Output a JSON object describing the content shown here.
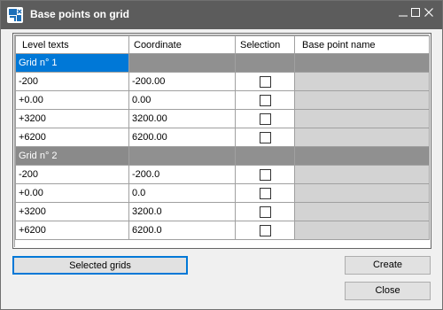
{
  "window": {
    "title": "Base points on grid"
  },
  "table": {
    "headers": [
      "Level texts",
      "Coordinate",
      "Selection",
      "Base point name"
    ],
    "groups": [
      {
        "name": "Grid n° 1",
        "selected": true,
        "rows": [
          {
            "level": "-200",
            "coordinate": "-200.00",
            "checked": false,
            "base_point_name": ""
          },
          {
            "level": "+0.00",
            "coordinate": "0.00",
            "checked": false,
            "base_point_name": ""
          },
          {
            "level": "+3200",
            "coordinate": "3200.00",
            "checked": false,
            "base_point_name": ""
          },
          {
            "level": "+6200",
            "coordinate": "6200.00",
            "checked": false,
            "base_point_name": ""
          }
        ]
      },
      {
        "name": "Grid n° 2",
        "selected": false,
        "rows": [
          {
            "level": "-200",
            "coordinate": "-200.0",
            "checked": false,
            "base_point_name": ""
          },
          {
            "level": "+0.00",
            "coordinate": "0.0",
            "checked": false,
            "base_point_name": ""
          },
          {
            "level": "+3200",
            "coordinate": "3200.0",
            "checked": false,
            "base_point_name": ""
          },
          {
            "level": "+6200",
            "coordinate": "6200.0",
            "checked": false,
            "base_point_name": ""
          }
        ]
      }
    ]
  },
  "buttons": {
    "selected_grids": "Selected grids",
    "create": "Create",
    "close": "Close"
  },
  "colors": {
    "titlebar": "#5c5c5c",
    "selection_blue": "#0078d7",
    "group_row": "#909090",
    "readonly_cell": "#d3d3d3"
  }
}
